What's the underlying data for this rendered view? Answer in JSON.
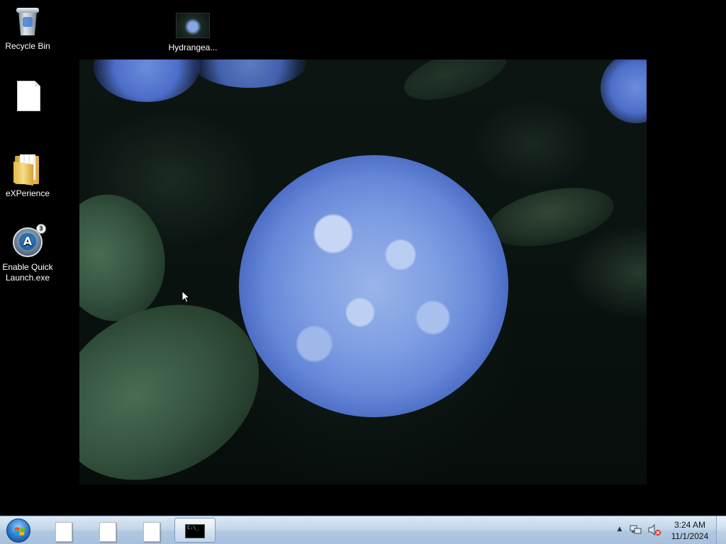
{
  "desktop": {
    "icons": [
      {
        "label": "Recycle Bin",
        "icon": "recycle-bin-icon"
      },
      {
        "label": "",
        "icon": "blank-file-icon"
      },
      {
        "label": "eXPerience",
        "icon": "folder-icon"
      },
      {
        "label": "Enable Quick Launch.exe",
        "icon": "quick-launch-app-icon"
      },
      {
        "label": "Hydrangea...",
        "icon": "image-thumbnail-icon"
      }
    ],
    "wallpaper": "hydrangea-photo"
  },
  "taskbar": {
    "start_label": "Start",
    "buttons": [
      {
        "icon": "blank-file-icon"
      },
      {
        "icon": "blank-file-icon"
      },
      {
        "icon": "blank-file-icon"
      },
      {
        "icon": "command-prompt-icon",
        "glyph_text": "C:\\_",
        "active": true
      }
    ],
    "tray": {
      "icons": [
        "show-hidden-icons-arrow",
        "network-icon",
        "volume-muted-icon"
      ],
      "time": "3:24 AM",
      "date": "11/1/2024"
    }
  },
  "colors": {
    "taskbar_top": "#dce8f4",
    "taskbar_bottom": "#a7c0dc",
    "flower_blue": "#7f9ee2",
    "leaf_green": "#36563f"
  }
}
